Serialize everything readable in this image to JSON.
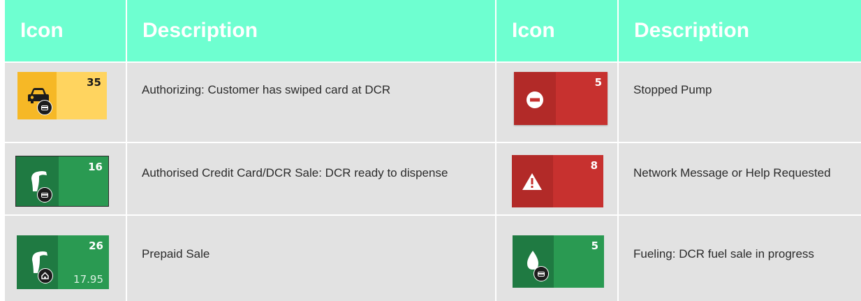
{
  "headers": {
    "icon_left": "Icon",
    "description_left": "Description",
    "icon_right": "Icon",
    "description_right": "Description"
  },
  "colors": {
    "header_bg": "#6effd0",
    "cell_bg": "#e2e2e2",
    "yellow_tile": "#ffd45f",
    "yellow_tile_dark": "#f6b826",
    "red_tile": "#c7312f",
    "red_tile_dark": "#b22a28",
    "green_tile": "#2a9a52",
    "green_tile_dark": "#1f7a42"
  },
  "rows_left": [
    {
      "tile": {
        "style": "yellow",
        "number": "35",
        "icon": "car-card-icon"
      },
      "description": "Authorizing: Customer has swiped card at DCR"
    },
    {
      "tile": {
        "style": "green",
        "number": "16",
        "icon": "fuel-nozzle-card-icon"
      },
      "description": "Authorised Credit Card/DCR Sale: DCR ready to dispense"
    },
    {
      "tile": {
        "style": "green",
        "number": "26",
        "amount": "17.95",
        "icon": "fuel-nozzle-prepaid-icon"
      },
      "description": "Prepaid Sale"
    }
  ],
  "rows_right": [
    {
      "tile": {
        "style": "red",
        "number": "5",
        "icon": "stop-icon"
      },
      "description": "Stopped Pump"
    },
    {
      "tile": {
        "style": "red",
        "number": "8",
        "icon": "warning-icon"
      },
      "description": "Network Message or Help Requested"
    },
    {
      "tile": {
        "style": "green",
        "number": "5",
        "icon": "fuel-drop-card-icon"
      },
      "description": "Fueling: DCR fuel sale in progress"
    }
  ]
}
